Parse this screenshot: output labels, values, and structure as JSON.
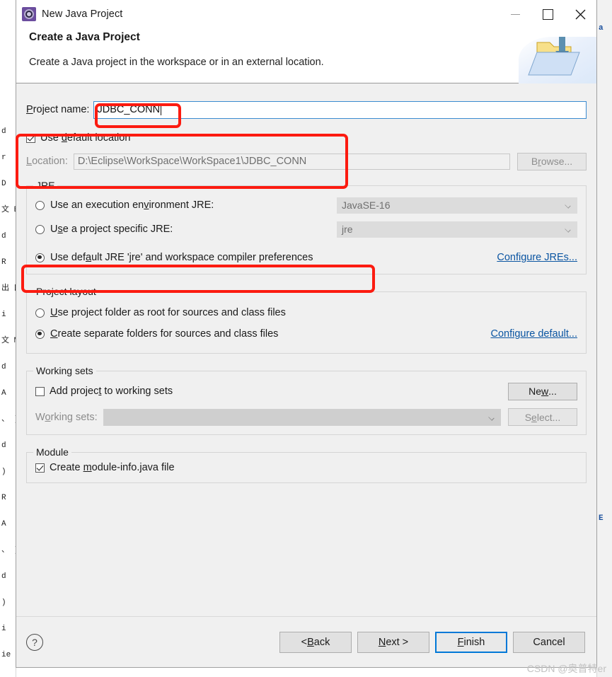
{
  "window": {
    "title": "New Java Project",
    "icon": "eclipse-wizard-icon",
    "minimize_label": "Minimize",
    "maximize_label": "Maximize",
    "close_label": "Close"
  },
  "header": {
    "title": "Create a Java Project",
    "description": "Create a Java project in the workspace or in an external location.",
    "banner_icon": "folder-with-arrow-icon"
  },
  "project_name": {
    "label": "Project name:",
    "label_mnemonic": "P",
    "label_rest": "roject name:",
    "value": "JDBC_CONN",
    "placeholder": ""
  },
  "location": {
    "use_default_label_pre": "Use ",
    "use_default_label_mnemonic": "d",
    "use_default_label_post": "efault location",
    "use_default_checked": true,
    "location_label_mnemonic": "L",
    "location_label_post": "ocation:",
    "location_value": "D:\\Eclipse\\WorkSpace\\WorkSpace1\\JDBC_CONN",
    "browse_label_pre": "B",
    "browse_label_mnemonic": "r",
    "browse_label_post": "owse...",
    "browse_disabled": true
  },
  "jre": {
    "group_title": "JRE",
    "options": [
      {
        "label_pre": "Use an execution en",
        "label_mnemonic": "v",
        "label_post": "ironment JRE:",
        "selected": false,
        "combo_value": "JavaSE-16",
        "combo_disabled": true
      },
      {
        "label_pre": "U",
        "label_mnemonic": "s",
        "label_post": "e a project specific JRE:",
        "selected": false,
        "combo_value": "jre",
        "combo_disabled": true
      },
      {
        "label_pre": "Use def",
        "label_mnemonic": "a",
        "label_post": "ult JRE 'jre' and workspace compiler preferences",
        "selected": true,
        "combo_value": null,
        "combo_disabled": true
      }
    ],
    "configure_link": "Configure JREs..."
  },
  "project_layout": {
    "group_title": "Project layout",
    "options": [
      {
        "label_mnemonic": "U",
        "label_post": "se project folder as root for sources and class files",
        "selected": false
      },
      {
        "label_mnemonic": "C",
        "label_post": "reate separate folders for sources and class files",
        "selected": true
      }
    ],
    "configure_link": "Configure default..."
  },
  "working_sets": {
    "group_title": "Working sets",
    "add_label_pre": "Add projec",
    "add_label_mnemonic": "t",
    "add_label_post": " to working sets",
    "add_checked": false,
    "new_button_pre": "Ne",
    "new_button_mnemonic": "w",
    "new_button_post": "...",
    "sets_label_pre": "W",
    "sets_label_mnemonic": "o",
    "sets_label_post": "rking sets:",
    "sets_value": "",
    "select_button_pre": "S",
    "select_button_mnemonic": "e",
    "select_button_post": "lect...",
    "select_disabled": true
  },
  "module": {
    "group_title": "Module",
    "create_label_pre": "Create ",
    "create_label_mnemonic": "m",
    "create_label_post": "odule-info.java file",
    "create_checked": true
  },
  "footer": {
    "help_icon": "question-mark-icon",
    "buttons": [
      {
        "name": "back",
        "pre": "< ",
        "mnemonic": "B",
        "post": "ack",
        "default": false
      },
      {
        "name": "next",
        "pre": "",
        "mnemonic": "N",
        "post": "ext >",
        "default": false
      },
      {
        "name": "finish",
        "pre": "",
        "mnemonic": "F",
        "post": "inish",
        "default": true
      },
      {
        "name": "cancel",
        "pre": "",
        "mnemonic": "",
        "post": "Cancel",
        "default": false
      }
    ],
    "watermark": "CSDN @奥普特er"
  },
  "annotations": {
    "color": "#fc1b10",
    "boxes": [
      {
        "name": "project-name-highlight",
        "target": "project name input value"
      },
      {
        "name": "default-location-highlight",
        "target": "use default location block"
      },
      {
        "name": "default-jre-highlight",
        "target": "use default JRE radio option"
      }
    ]
  },
  "background": {
    "left_strip_lines": [
      "d",
      "r",
      "D",
      "文 E",
      "d",
      "R",
      "出 口",
      "i",
      "文 M",
      "d",
      "A",
      "、 )",
      "d",
      ")",
      "R",
      "A",
      "、 )",
      "d",
      ")",
      "i",
      "ie"
    ],
    "right_strip_lines": [
      "a",
      "E"
    ]
  }
}
